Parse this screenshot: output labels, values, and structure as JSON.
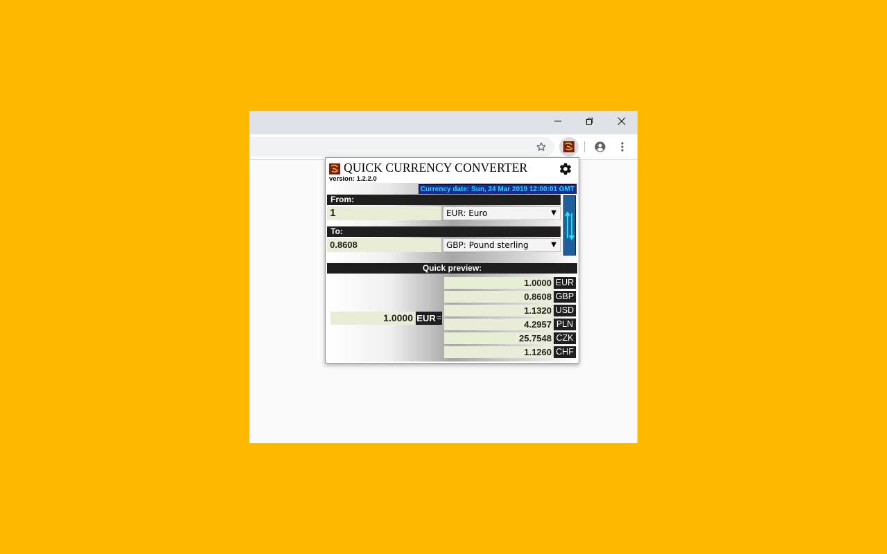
{
  "window": {
    "minimize_label": "minimize",
    "restore_label": "restore",
    "close_label": "close"
  },
  "toolbar": {
    "bookmark_icon": "star-icon",
    "extension_icon": "quick-currency-converter-icon",
    "profile_icon": "account-circle-icon",
    "menu_icon": "more-vert-icon"
  },
  "popup": {
    "title": "QUICK CURRENCY CONVERTER",
    "version": "version: 1.2.2.0",
    "currency_date": "Currency date: Sun, 24 Mar 2019 12:00:01 GMT",
    "from_label": "From:",
    "from_amount": "1",
    "from_currency": "EUR: Euro",
    "to_label": "To:",
    "to_amount": "0.8608",
    "to_currency": "GBP: Pound sterling",
    "quick_preview_label": "Quick preview:",
    "preview_base_value": "1.0000",
    "preview_base_currency": "EUR",
    "equals": "=",
    "preview_rows": [
      {
        "value": "1.0000",
        "currency": "EUR"
      },
      {
        "value": "0.8608",
        "currency": "GBP"
      },
      {
        "value": "1.1320",
        "currency": "USD"
      },
      {
        "value": "4.2957",
        "currency": "PLN"
      },
      {
        "value": "25.7548",
        "currency": "CZK"
      },
      {
        "value": "1.1260",
        "currency": "CHF"
      }
    ]
  },
  "colors": {
    "background": "#FFB901",
    "date_label_bg": "#1B2A9A",
    "date_label_text": "#18E0F0",
    "field_bg": "#E8EDD5",
    "swap_button": "#1F5F9E"
  }
}
